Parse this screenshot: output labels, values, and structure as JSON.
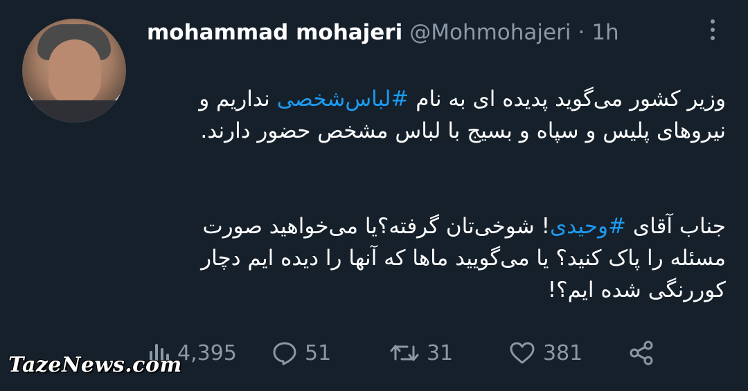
{
  "author": {
    "name": "mohammad mohajeri",
    "handle": "@Mohmohajeri",
    "separator": "·",
    "time": "1h"
  },
  "icons": {
    "more": "more-vertical-icon",
    "views": "views-chart-icon",
    "reply": "reply-bubble-icon",
    "retweet": "retweet-icon",
    "like": "heart-icon",
    "share": "share-icon"
  },
  "tweet": {
    "p1_before": "وزیر کشور می‌گوید پدیده ای به نام ",
    "p1_hashtag": "#لباس‌شخصی",
    "p1_after": " نداریم و نیروهای پلیس و سپاه و بسیج با لباس مشخص حضور دارند.",
    "p2_before": "جناب آقای ",
    "p2_hashtag": "#وحیدی",
    "p2_after": "! شوخی‌تان گرفته؟یا می‌خواهید صورت مسئله را پاک کنید؟ یا می‌گویید ماها که آنها را دیده ایم دچار کوررنگی شده ایم؟!"
  },
  "stats": {
    "views": "4,395",
    "replies": "51",
    "retweets": "31",
    "likes": "381"
  },
  "watermark": "TazeNews.com",
  "colors": {
    "background": "#15202b",
    "text": "#ffffff",
    "muted": "#8b98a5",
    "link": "#1d9bf0"
  }
}
